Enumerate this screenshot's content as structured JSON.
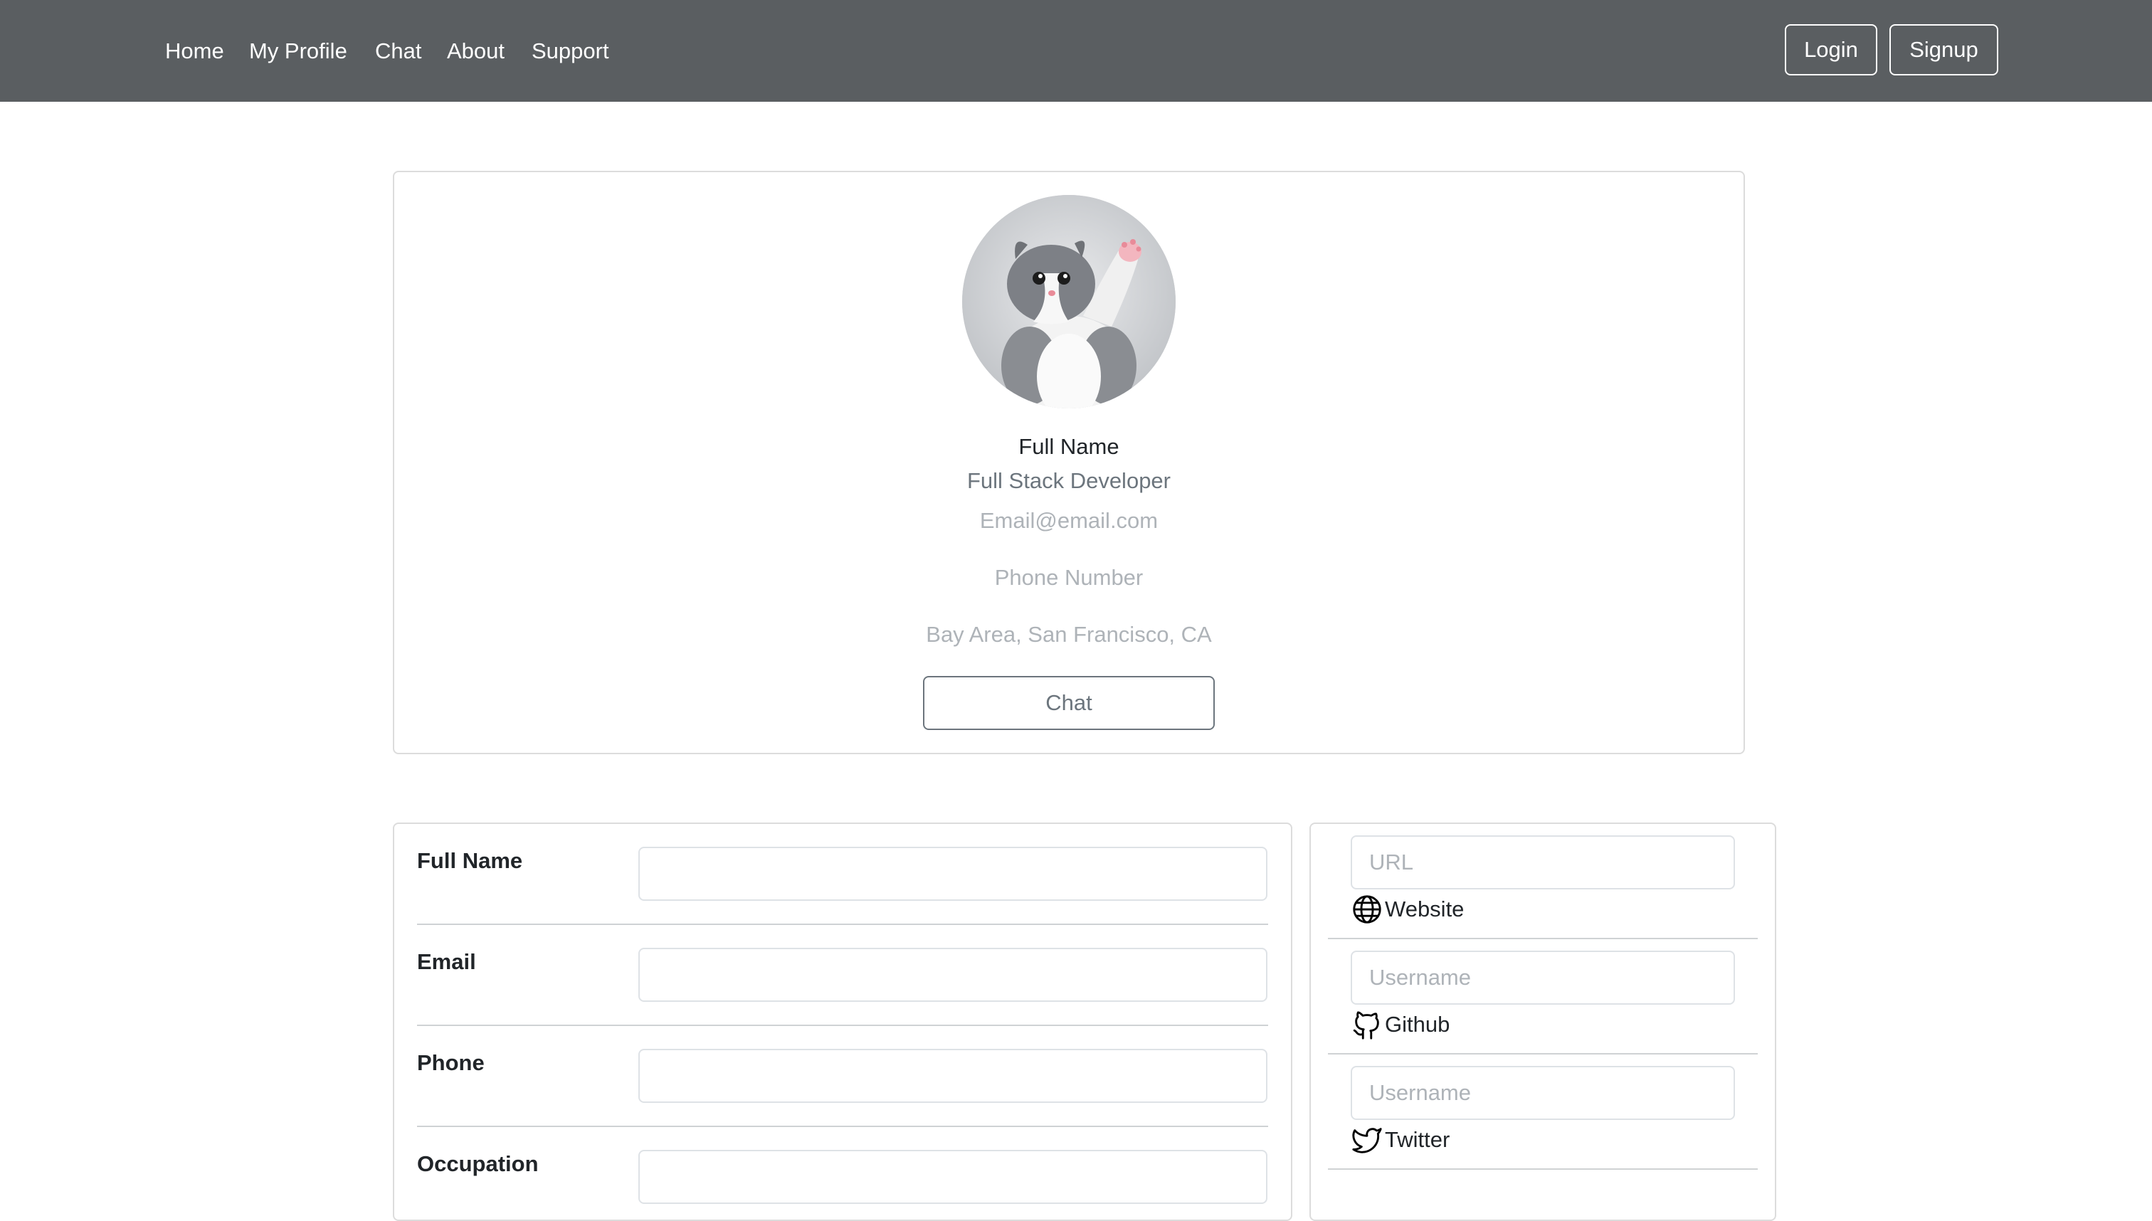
{
  "nav": {
    "links": [
      "Home",
      "My Profile",
      "Chat",
      "About",
      "Support"
    ],
    "login_label": "Login",
    "signup_label": "Signup"
  },
  "profile": {
    "full_name": "Full Name",
    "occupation": "Full Stack Developer",
    "email": "Email@email.com",
    "phone": "Phone Number",
    "location": "Bay Area, San Francisco, CA",
    "chat_label": "Chat",
    "avatar_icon": "kitten-photo"
  },
  "form": {
    "fields": [
      {
        "label": "Full Name",
        "value": ""
      },
      {
        "label": "Email",
        "value": ""
      },
      {
        "label": "Phone",
        "value": ""
      },
      {
        "label": "Occupation",
        "value": ""
      }
    ]
  },
  "social": {
    "items": [
      {
        "label": "Website",
        "placeholder": "URL",
        "icon": "globe-icon"
      },
      {
        "label": "Github",
        "placeholder": "Username",
        "icon": "github-icon"
      },
      {
        "label": "Twitter",
        "placeholder": "Username",
        "icon": "twitter-icon"
      }
    ]
  },
  "colors": {
    "navbar": "#5a5e61",
    "muted_text": "#6c757d",
    "placeholder_text": "#aeb3b8"
  }
}
